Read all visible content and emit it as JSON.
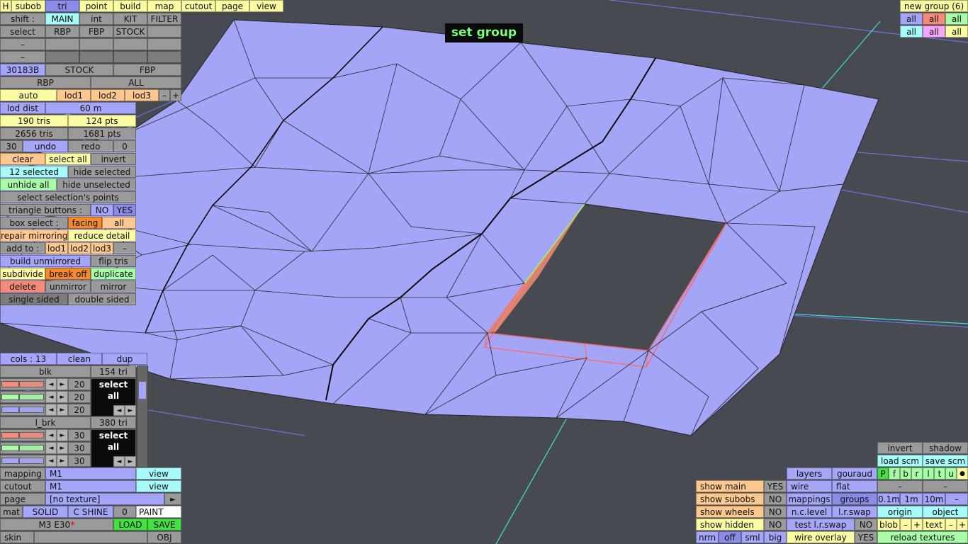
{
  "banner": "set group",
  "top_bar": {
    "h": "H",
    "subob": "subob",
    "tri": "tri",
    "point": "point",
    "build": "build",
    "map": "map",
    "cutout": "cutout",
    "page": "page",
    "view": "view"
  },
  "shift_row": {
    "label": "shift :",
    "main": "MAIN",
    "int": "int",
    "kit": "KIT",
    "filter": "FILTER"
  },
  "select_row": {
    "label": "select",
    "rbp": "RBP",
    "fbp": "FBP",
    "stock": "STOCK"
  },
  "dash": "–",
  "id_row": {
    "code": "30183B",
    "stock": "STOCK",
    "fbp": "FBP"
  },
  "rbp_all": {
    "rbp": "RBP",
    "all": "ALL"
  },
  "lod_row": {
    "auto": "auto",
    "lod1": "lod1",
    "lod2": "lod2",
    "lod3": "lod3",
    "minus": "–",
    "plus": "+"
  },
  "lod_dist": {
    "label": "lod dist",
    "value": "60 m"
  },
  "counts": {
    "tris1": "190 tris",
    "pts1": "124 pts",
    "tris2": "2656 tris",
    "pts2": "1681 pts"
  },
  "undo_row": {
    "n": "30",
    "undo": "undo",
    "redo": "redo",
    "zero": "0"
  },
  "edit": {
    "clear": "clear",
    "select_all": "select all",
    "invert": "invert",
    "selected": "12 selected",
    "hide_selected": "hide selected",
    "unhide_all": "unhide all",
    "hide_unselected": "hide unselected",
    "select_points": "select selection's points"
  },
  "tri_buttons": {
    "label": "triangle buttons :",
    "no": "NO",
    "yes": "YES"
  },
  "box_select": {
    "label": "box select :",
    "facing": "facing",
    "all": "all"
  },
  "repair": {
    "mirroring": "repair mirroring",
    "reduce": "reduce detail"
  },
  "add_to": {
    "label": "add to :",
    "lod1": "lod1",
    "lod2": "lod2",
    "lod3": "lod3",
    "minus": "–"
  },
  "ops": {
    "build_unmirrored": "build unmirrored",
    "flip_tris": "flip tris",
    "subdivide": "subdivide",
    "break_off": "break off",
    "duplicate": "duplicate",
    "delete": "delete",
    "unmirror": "unmirror",
    "mirror": "mirror",
    "single_sided": "single sided",
    "double_sided": "double sided"
  },
  "cols_row": {
    "cols": "cols : 13",
    "clean": "clean",
    "dup": "dup"
  },
  "materials": [
    {
      "name": "blk",
      "tris": "154 tri",
      "values": [
        "20",
        "20",
        "20"
      ],
      "select_all": "select all"
    },
    {
      "name": "l_brk",
      "tris": "380 tri",
      "values": [
        "30",
        "30",
        "30"
      ],
      "select_all": "select all"
    }
  ],
  "arrows": {
    "left": "◄",
    "right": "►"
  },
  "bottom_left": {
    "mapping_label": "mapping",
    "mapping_val": "M1",
    "mapping_view": "view",
    "cutout_label": "cutout",
    "cutout_val": "M1",
    "cutout_view": "view",
    "page_label": "page",
    "page_val": "[no texture]",
    "page_arrow": "►",
    "mat": "mat",
    "solid": "SOLID",
    "shine": "C SHINE",
    "zero": "0",
    "paint": "PAINT",
    "model": "M3 E30",
    "star": "*",
    "load": "LOAD",
    "save": "SAVE",
    "skin": "skin",
    "obj": "OBJ"
  },
  "top_right": {
    "new_group": "new group (6)",
    "all": "all"
  },
  "br_grid": {
    "invert": "invert",
    "shadow": "shadow",
    "load_scm": "load scm",
    "save_scm": "save scm",
    "letters": [
      "P",
      "f",
      "b",
      "r",
      "l",
      "t",
      "u"
    ],
    "dot": "●",
    "minus": "–",
    "d01": "0.1m",
    "d1": "1m",
    "d10": "10m",
    "origin": "origin",
    "object": "object",
    "blob": "blob",
    "text": "text",
    "plus": "+",
    "reload": "reload textures"
  },
  "br_mid": {
    "layers": "layers",
    "gouraud": "gouraud",
    "wire": "wire",
    "flat": "flat",
    "mappings": "mappings",
    "groups": "groups",
    "nclevel": "n.c.level",
    "lrswap": "l.r.swap",
    "test_lrswap": "test l.r.swap",
    "no": "NO",
    "wire_overlay": "wire overlay",
    "yes": "YES"
  },
  "br_show": {
    "main": "show main",
    "main_val": "YES",
    "subobs": "show subobs",
    "subobs_val": "NO",
    "wheels": "show wheels",
    "wheels_val": "NO",
    "hidden": "show hidden",
    "hidden_val": "NO",
    "nrm": "nrm",
    "off": "off",
    "sml": "sml",
    "big": "big"
  }
}
